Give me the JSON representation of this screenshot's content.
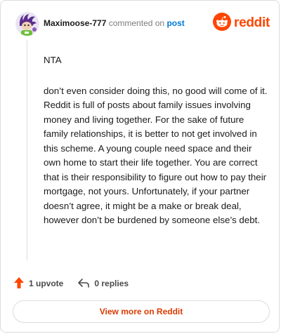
{
  "comment": {
    "username": "Maximoose-777",
    "verb": "commented on",
    "post_link": "post",
    "paragraphs": [
      "NTA",
      "don’t even consider doing this, no good will come of it. Reddit is full of posts about family issues involving money and living together. For the sake of future family relationships, it is better to not get involved in this scheme. A young couple need space and their own home to start their life together. You are correct that is their responsibility to figure out how to pay their mortgage, not yours. Unfortunately, if your partner doesn’t agree, it might be a make or break deal, however don’t be burdened by someone else’s debt."
    ]
  },
  "brand": {
    "name": "reddit",
    "color": "#ff4500",
    "icon": "reddit-snoo-icon"
  },
  "actions": {
    "upvotes": "1 upvote",
    "upvote_icon": "arrow-up-icon",
    "upvote_color": "#ff4500",
    "replies": "0 replies",
    "reply_icon": "reply-arrow-icon"
  },
  "footer": {
    "view_more": "View more on Reddit",
    "color": "#d93a00"
  },
  "colors": {
    "link": "#0079d3",
    "muted": "#7c7c7c"
  }
}
